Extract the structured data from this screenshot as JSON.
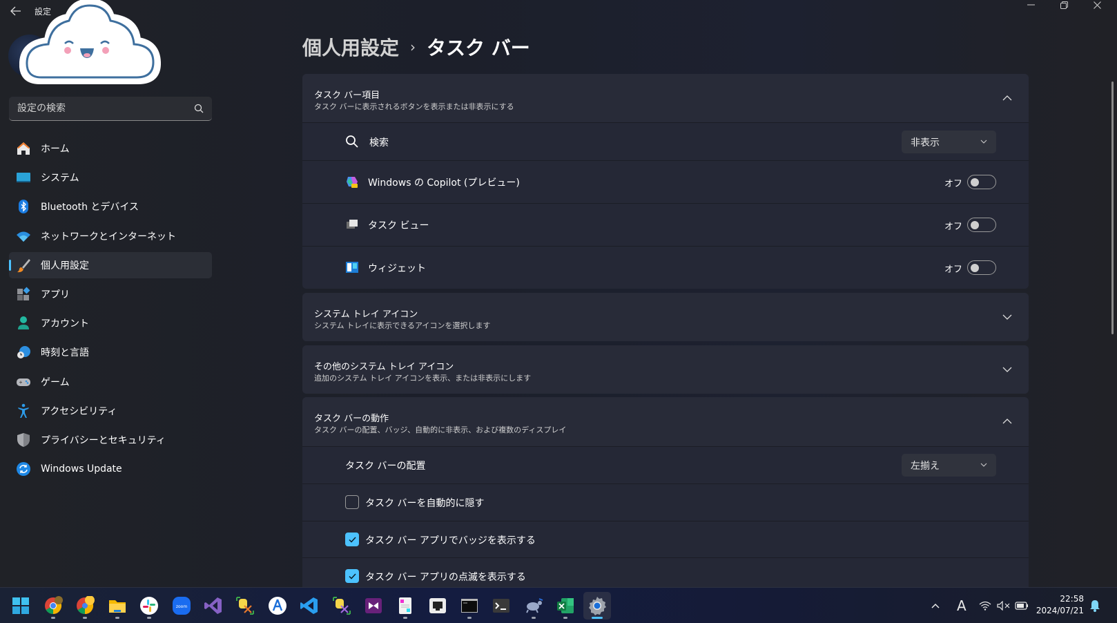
{
  "window": {
    "title": "設定",
    "controls": {
      "minimize": "—",
      "maximize": "❐",
      "close": "✕"
    }
  },
  "sidebar": {
    "search": {
      "placeholder": "設定の検索",
      "value": ""
    },
    "items": [
      {
        "label": "ホーム",
        "icon": "home-icon",
        "selected": false
      },
      {
        "label": "システム",
        "icon": "system-icon",
        "selected": false
      },
      {
        "label": "Bluetooth とデバイス",
        "icon": "bluetooth-icon",
        "selected": false
      },
      {
        "label": "ネットワークとインターネット",
        "icon": "wifi-icon",
        "selected": false
      },
      {
        "label": "個人用設定",
        "icon": "brush-icon",
        "selected": true
      },
      {
        "label": "アプリ",
        "icon": "apps-icon",
        "selected": false
      },
      {
        "label": "アカウント",
        "icon": "account-icon",
        "selected": false
      },
      {
        "label": "時刻と言語",
        "icon": "time-language-icon",
        "selected": false
      },
      {
        "label": "ゲーム",
        "icon": "gamepad-icon",
        "selected": false
      },
      {
        "label": "アクセシビリティ",
        "icon": "accessibility-icon",
        "selected": false
      },
      {
        "label": "プライバシーとセキュリティ",
        "icon": "shield-icon",
        "selected": false
      },
      {
        "label": "Windows Update",
        "icon": "windows-update-icon",
        "selected": false
      }
    ]
  },
  "breadcrumb": {
    "parent": "個人用設定",
    "separator": "›",
    "current": "タスク バー"
  },
  "sections": {
    "taskbar_items": {
      "title": "タスク バー項目",
      "desc": "タスク バーに表示されるボタンを表示または非表示にする",
      "expanded": true,
      "rows": {
        "search": {
          "label": "検索",
          "value": "非表示"
        },
        "copilot": {
          "label": "Windows の Copilot (プレビュー)",
          "state_text": "オフ",
          "on": false
        },
        "taskview": {
          "label": "タスク ビュー",
          "state_text": "オフ",
          "on": false
        },
        "widgets": {
          "label": "ウィジェット",
          "state_text": "オフ",
          "on": false
        }
      }
    },
    "system_tray": {
      "title": "システム トレイ アイコン",
      "desc": "システム トレイに表示できるアイコンを選択します",
      "expanded": false
    },
    "other_tray": {
      "title": "その他のシステム トレイ アイコン",
      "desc": "追加のシステム トレイ アイコンを表示、または非表示にします",
      "expanded": false
    },
    "behaviors": {
      "title": "タスク バーの動作",
      "desc": "タスク バーの配置、バッジ、自動的に非表示、および複数のディスプレイ",
      "expanded": true,
      "rows": {
        "alignment": {
          "label": "タスク バーの配置",
          "value": "左揃え"
        },
        "autohide": {
          "label": "タスク バーを自動的に隠す",
          "checked": false
        },
        "badges": {
          "label": "タスク バー アプリでバッジを表示する",
          "checked": true
        },
        "flashing": {
          "label": "タスク バー アプリの点滅を表示する",
          "checked": true
        }
      }
    }
  },
  "taskbar": {
    "apps": [
      {
        "name": "start",
        "running": false
      },
      {
        "name": "chrome",
        "running": true
      },
      {
        "name": "chrome-profile-2",
        "running": true
      },
      {
        "name": "file-explorer",
        "running": true
      },
      {
        "name": "slack",
        "running": true
      },
      {
        "name": "zoom",
        "running": false
      },
      {
        "name": "visual-studio",
        "running": false
      },
      {
        "name": "db-tool",
        "running": false
      },
      {
        "name": "android-studio",
        "running": false
      },
      {
        "name": "vscode",
        "running": false
      },
      {
        "name": "db-tool-2",
        "running": false
      },
      {
        "name": "visual-studio-preview",
        "running": false
      },
      {
        "name": "notepad",
        "running": true
      },
      {
        "name": "network-tool",
        "running": false
      },
      {
        "name": "command-prompt",
        "running": true
      },
      {
        "name": "terminal",
        "running": false
      },
      {
        "name": "tortoise",
        "running": true
      },
      {
        "name": "excel",
        "running": true
      },
      {
        "name": "settings",
        "running": true,
        "active": true
      }
    ],
    "tray": {
      "ime": "A",
      "time": "22:58",
      "date": "2024/07/21"
    }
  },
  "colors": {
    "accent": "#4cc2ff",
    "background": "#1c1f27",
    "card": "#272a37"
  }
}
